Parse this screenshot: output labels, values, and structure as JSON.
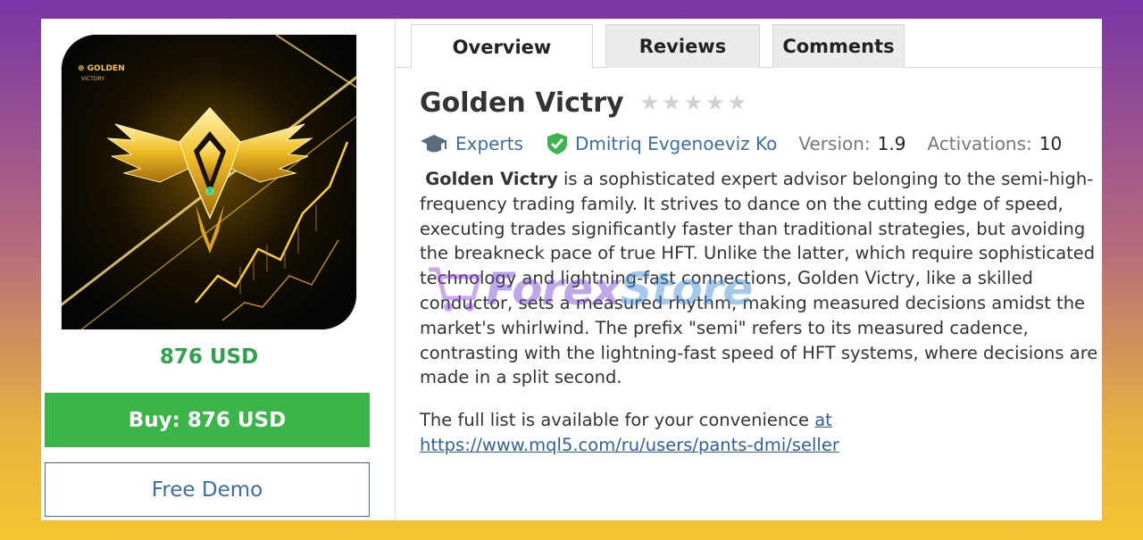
{
  "tabs": [
    {
      "label": "Overview",
      "active": true
    },
    {
      "label": "Reviews",
      "active": false
    },
    {
      "label": "Comments",
      "active": false
    }
  ],
  "product": {
    "title": "Golden Victry",
    "rating": 0,
    "max_rating": 5,
    "category": "Experts",
    "author": "Dmitriq Evgenoeviz Ko",
    "version_label": "Version:",
    "version": "1.9",
    "activations_label": "Activations:",
    "activations": "10",
    "price": "876 USD",
    "image_logo_text": "GOLDEN VICTORY"
  },
  "buttons": {
    "buy": "Buy: 876 USD",
    "demo": "Free Demo"
  },
  "description": {
    "lead": "Golden Victry",
    "body": " is a sophisticated expert advisor belonging to the semi-high-frequency trading family. It strives to dance on the cutting edge of speed, executing trades significantly faster than traditional strategies, but avoiding the breakneck pace of true HFT. Unlike the latter, which require sophisticated technology and lightning-fast connections, Golden Victry, like a skilled conductor, sets a measured rhythm, making measured decisions amidst the market's whirlwind. The prefix \"semi\" refers to its measured cadence, contrasting with the lightning-fast speed of HFT systems, where decisions are made in a split second."
  },
  "full_list": {
    "text": "The full list is available for your convenience ",
    "link_text": "at https://www.mql5.com/ru/users/pants-dmi/seller"
  },
  "watermark": {
    "part1": "Forex",
    "part2": "Store"
  },
  "colors": {
    "buy_bg": "#3bb54a",
    "price": "#2fa34a",
    "link": "#3a6eaa",
    "verified": "#3bb54a"
  },
  "icons": {
    "category": "graduation-cap-icon",
    "author": "verified-shield-icon",
    "rating": "star-icon"
  }
}
